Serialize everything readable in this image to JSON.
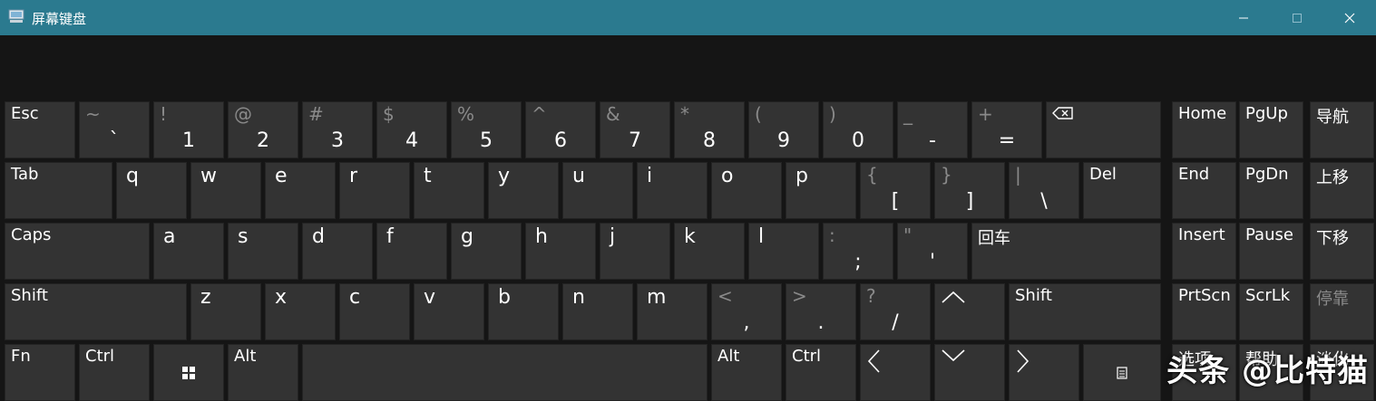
{
  "window": {
    "title": "屏幕键盘"
  },
  "row1": [
    {
      "shift": "",
      "main": "Esc"
    },
    {
      "shift": "~",
      "main": "`"
    },
    {
      "shift": "!",
      "main": "1"
    },
    {
      "shift": "@",
      "main": "2"
    },
    {
      "shift": "#",
      "main": "3"
    },
    {
      "shift": "$",
      "main": "4"
    },
    {
      "shift": "%",
      "main": "5"
    },
    {
      "shift": "^",
      "main": "6"
    },
    {
      "shift": "&",
      "main": "7"
    },
    {
      "shift": "*",
      "main": "8"
    },
    {
      "shift": "(",
      "main": "9"
    },
    {
      "shift": ")",
      "main": "0"
    },
    {
      "shift": "_",
      "main": "-"
    },
    {
      "shift": "+",
      "main": "="
    }
  ],
  "row2_letters": [
    "q",
    "w",
    "e",
    "r",
    "t",
    "y",
    "u",
    "i",
    "o",
    "p"
  ],
  "row2_brackets": [
    {
      "shift": "{",
      "main": "["
    },
    {
      "shift": "}",
      "main": "]"
    },
    {
      "shift": "|",
      "main": "\\"
    }
  ],
  "row3_letters": [
    "a",
    "s",
    "d",
    "f",
    "g",
    "h",
    "j",
    "k",
    "l"
  ],
  "row3_punct": [
    {
      "shift": ":",
      "main": ";"
    },
    {
      "shift": "\"",
      "main": "'"
    }
  ],
  "row4_letters": [
    "z",
    "x",
    "c",
    "v",
    "b",
    "n",
    "m"
  ],
  "row4_punct": [
    {
      "shift": "<",
      "main": ","
    },
    {
      "shift": ">",
      "main": "."
    },
    {
      "shift": "?",
      "main": "/"
    }
  ],
  "labels": {
    "tab": "Tab",
    "del": "Del",
    "caps": "Caps",
    "enter": "回车",
    "shift": "Shift",
    "fn": "Fn",
    "ctrl": "Ctrl",
    "alt": "Alt"
  },
  "nav": {
    "home": "Home",
    "pgup": "PgUp",
    "nav": "导航",
    "end": "End",
    "pgdn": "PgDn",
    "moveup": "上移",
    "insert": "Insert",
    "pause": "Pause",
    "movedown": "下移",
    "prtscn": "PrtScn",
    "scrlk": "ScrLk",
    "dock": "停靠",
    "options": "选项",
    "help": "帮助",
    "fade": "淡化"
  },
  "watermark": "头条 @比特猫"
}
